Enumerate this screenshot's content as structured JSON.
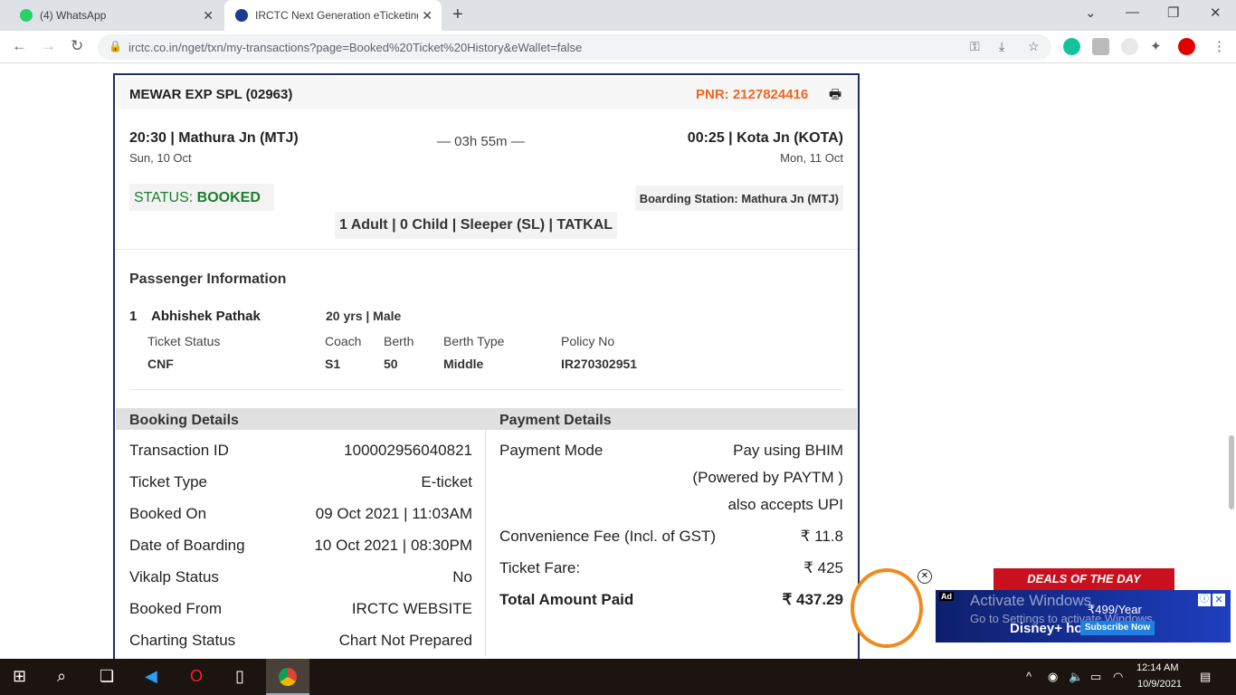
{
  "browser": {
    "tabs": [
      {
        "title": "(4) WhatsApp"
      },
      {
        "title": "IRCTC Next Generation eTicketing"
      }
    ],
    "url": "irctc.co.in/nget/txn/my-transactions?page=Booked%20Ticket%20History&eWallet=false"
  },
  "ticket": {
    "train": "MEWAR EXP SPL (02963)",
    "pnr": "PNR: 2127824416",
    "from_time_station": "20:30 | Mathura Jn (MTJ)",
    "from_date": "Sun, 10 Oct",
    "duration": "— 03h 55m —",
    "to_time_station": "00:25 | Kota Jn (KOTA)",
    "to_date": "Mon, 11 Oct",
    "status_label": "STATUS: ",
    "status_value": "BOOKED",
    "boarding": "Boarding Station: Mathura Jn (MTJ)",
    "class_info": "1 Adult | 0 Child | Sleeper (SL) | TATKAL"
  },
  "passenger": {
    "heading": "Passenger Information",
    "index": "1",
    "name": "Abhishek Pathak",
    "age_gender": "20 yrs | Male",
    "headers": [
      "Ticket Status",
      "Coach",
      "Berth",
      "Berth Type",
      "Policy No"
    ],
    "values": [
      "CNF",
      "S1",
      "50",
      "Middle",
      "IR270302951"
    ]
  },
  "booking": {
    "heading": "Booking Details",
    "rows": [
      {
        "label": "Transaction ID",
        "value": "100002956040821"
      },
      {
        "label": "Ticket Type",
        "value": "E-ticket"
      },
      {
        "label": "Booked On",
        "value": "09 Oct 2021 | 11:03AM"
      },
      {
        "label": "Date of Boarding",
        "value": "10 Oct 2021 | 08:30PM"
      },
      {
        "label": "Vikalp Status",
        "value": "No"
      },
      {
        "label": "Booked From",
        "value": "IRCTC WEBSITE"
      },
      {
        "label": "Charting Status",
        "value": "Chart Not Prepared"
      }
    ]
  },
  "payment": {
    "heading": "Payment Details",
    "mode_label": "Payment Mode",
    "mode_lines": [
      "Pay using BHIM",
      "(Powered by PAYTM )",
      "also accepts UPI"
    ],
    "fee_label": "Convenience Fee (Incl. of GST)",
    "fee_value": "₹ 11.8",
    "fare_label": "Ticket Fare:",
    "fare_value": "₹ 425",
    "total_label": "Total Amount Paid",
    "total_value": "₹ 437.29"
  },
  "ad": {
    "deals": "DEALS OF THE DAY",
    "tag": "Ad",
    "activate1": "Activate Windows",
    "activate2": "Go to Settings to activate Windows.",
    "brand": "Disney+ hotstar",
    "price": "₹499/Year",
    "cta": "Subscribe Now"
  },
  "taskbar": {
    "time": "12:14 AM",
    "date": "10/9/2021"
  },
  "colors": {
    "pnr": "#f26522",
    "status": "#1a7f2b",
    "card_border": "#1a2f6b"
  }
}
